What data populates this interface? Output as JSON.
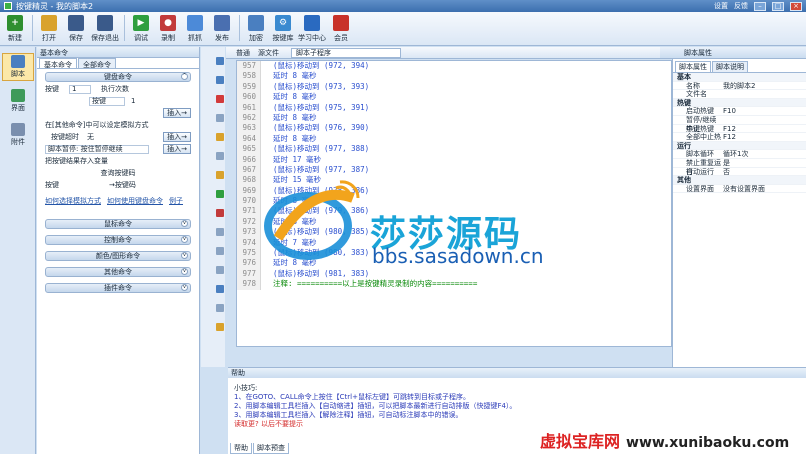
{
  "window": {
    "title": "按键精灵 - 我的脚本2",
    "right_items": [
      "设置",
      "反馈"
    ]
  },
  "toolbar": {
    "buttons": [
      {
        "label": "新建",
        "color": "#2f8f2f"
      },
      {
        "label": "打开",
        "color": "#3b74c4"
      },
      {
        "label": "保存",
        "color": "#3a5a8a"
      },
      {
        "label": "保存退出",
        "color": "#3a5a8a"
      },
      {
        "label": "调试",
        "color": "#2f9f3f"
      },
      {
        "label": "录制",
        "color": "#c23b3b"
      },
      {
        "label": "抓抓",
        "color": "#4c8ad8"
      },
      {
        "label": "发布",
        "color": "#4a6fb0"
      },
      {
        "label": "加密",
        "color": "#4a7fc0"
      },
      {
        "label": "按键库",
        "color": "#3a8ad0"
      },
      {
        "label": "学习中心",
        "color": "#2a6ac0"
      },
      {
        "label": "会员",
        "color": "#c8322a"
      }
    ]
  },
  "leftnav": {
    "items": [
      {
        "label": "脚本",
        "active": true
      },
      {
        "label": "界面",
        "active": false
      },
      {
        "label": "附件",
        "active": false
      }
    ]
  },
  "cmdpanel": {
    "header": "基本命令",
    "tabs": [
      "基本命令",
      "全部命令"
    ],
    "group_keyboard": "键盘命令",
    "labels": {
      "key": "按键",
      "times_label": "执行次数",
      "key_value": "1",
      "mode": "按键",
      "key_count": "1"
    },
    "insert": "插入→",
    "info1": "在[其他命令]中可以设定模拟方式",
    "wait_label": "按键超时",
    "wait_value": "无",
    "script_lock_label": "脚本暂停: 按住暂停继续",
    "save_to_var": "把按键结果存入变量",
    "query": "查询按键码",
    "key2": "按键",
    "to_code": "→按键码",
    "link1": "如何选择模拟方式",
    "link2": "如何使用键盘命令",
    "link3": "例子",
    "groups": [
      "鼠标命令",
      "控制命令",
      "颜色/图形命令",
      "其他命令",
      "插件命令"
    ]
  },
  "editor_bar": {
    "tab1": "普通",
    "tab2": "源文件",
    "select": "脚本子程序"
  },
  "editor": {
    "lines": [
      {
        "n": "957",
        "code": "(鼠标)移动到 (972, 394)",
        "kind": "blue"
      },
      {
        "n": "958",
        "code": "延时 8 毫秒",
        "kind": "blue"
      },
      {
        "n": "959",
        "code": "(鼠标)移动到 (973, 393)",
        "kind": "blue"
      },
      {
        "n": "960",
        "code": "延时 8 毫秒",
        "kind": "blue"
      },
      {
        "n": "961",
        "code": "(鼠标)移动到 (975, 391)",
        "kind": "blue"
      },
      {
        "n": "962",
        "code": "延时 8 毫秒",
        "kind": "blue"
      },
      {
        "n": "963",
        "code": "(鼠标)移动到 (976, 390)",
        "kind": "blue"
      },
      {
        "n": "964",
        "code": "延时 8 毫秒",
        "kind": "blue"
      },
      {
        "n": "965",
        "code": "(鼠标)移动到 (977, 388)",
        "kind": "blue"
      },
      {
        "n": "966",
        "code": "延时 17 毫秒",
        "kind": "blue"
      },
      {
        "n": "967",
        "code": "(鼠标)移动到 (977, 387)",
        "kind": "blue"
      },
      {
        "n": "968",
        "code": "延时 15 毫秒",
        "kind": "blue"
      },
      {
        "n": "969",
        "code": "(鼠标)移动到 (978, 386)",
        "kind": "blue"
      },
      {
        "n": "970",
        "code": "延时 8 毫秒",
        "kind": "blue"
      },
      {
        "n": "971",
        "code": "(鼠标)移动到 (979, 386)",
        "kind": "blue"
      },
      {
        "n": "972",
        "code": "延时 8 毫秒",
        "kind": "blue"
      },
      {
        "n": "973",
        "code": "(鼠标)移动到 (980, 385)",
        "kind": "blue"
      },
      {
        "n": "974",
        "code": "延时 7 毫秒",
        "kind": "blue"
      },
      {
        "n": "975",
        "code": "(鼠标)移动到 (980, 383)",
        "kind": "blue"
      },
      {
        "n": "976",
        "code": "延时 8 毫秒",
        "kind": "blue"
      },
      {
        "n": "977",
        "code": "(鼠标)移动到 (981, 383)",
        "kind": "blue"
      },
      {
        "n": "978",
        "code": "注释: ==========以上是按键精灵录制的内容==========",
        "kind": "green"
      }
    ]
  },
  "props": {
    "header": "脚本属性",
    "tabs": [
      "脚本属性",
      "脚本说明"
    ],
    "rows": [
      {
        "k": "基本",
        "v": "",
        "cat": true
      },
      {
        "k": "名称",
        "v": "我的脚本2"
      },
      {
        "k": "文件名",
        "v": ""
      },
      {
        "k": "热键",
        "v": "",
        "cat": true
      },
      {
        "k": "启动热键",
        "v": "F10"
      },
      {
        "k": "暂停/继续热键",
        "v": ""
      },
      {
        "k": "中止热键",
        "v": "F12"
      },
      {
        "k": "全部中止热键",
        "v": "F12"
      },
      {
        "k": "运行",
        "v": "",
        "cat": true
      },
      {
        "k": "脚本循环",
        "v": "循环1次"
      },
      {
        "k": "禁止重复运行",
        "v": "是"
      },
      {
        "k": "自动运行",
        "v": "否"
      },
      {
        "k": "其他",
        "v": "",
        "cat": true
      },
      {
        "k": "设置界面",
        "v": "没有设置界面"
      }
    ]
  },
  "help": {
    "header": "帮助",
    "title": "小技巧:",
    "tips": [
      "1、在GOTO、CALL命令上按住【Ctrl+鼠标左键】可跳转到目标或子程序。",
      "2、用脚本编辑工具栏插入【自动缩进】插钮，可以把脚本最新进行自动排版（快捷键F4）。",
      "3、用脚本编辑工具栏插入【解除注释】插钮，可自动标注脚本中的错误。"
    ],
    "more": "读取更? 以后不要提示",
    "tabs": [
      "帮助",
      "脚本预查"
    ]
  },
  "watermark": {
    "big": "莎莎源码",
    "url": "bbs.sasadown.cn",
    "bottom": "虚拟宝库网",
    "bottom_url": "www.xunibaoku.com"
  }
}
